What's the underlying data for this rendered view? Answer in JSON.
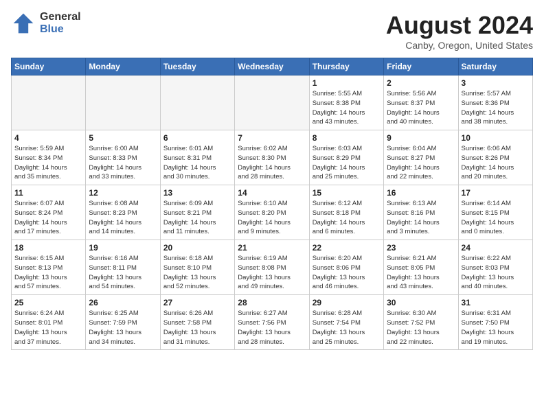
{
  "header": {
    "title": "August 2024",
    "location": "Canby, Oregon, United States",
    "logo_general": "General",
    "logo_blue": "Blue"
  },
  "weekdays": [
    "Sunday",
    "Monday",
    "Tuesday",
    "Wednesday",
    "Thursday",
    "Friday",
    "Saturday"
  ],
  "weeks": [
    [
      {
        "day": "",
        "info": ""
      },
      {
        "day": "",
        "info": ""
      },
      {
        "day": "",
        "info": ""
      },
      {
        "day": "",
        "info": ""
      },
      {
        "day": "1",
        "info": "Sunrise: 5:55 AM\nSunset: 8:38 PM\nDaylight: 14 hours\nand 43 minutes."
      },
      {
        "day": "2",
        "info": "Sunrise: 5:56 AM\nSunset: 8:37 PM\nDaylight: 14 hours\nand 40 minutes."
      },
      {
        "day": "3",
        "info": "Sunrise: 5:57 AM\nSunset: 8:36 PM\nDaylight: 14 hours\nand 38 minutes."
      }
    ],
    [
      {
        "day": "4",
        "info": "Sunrise: 5:59 AM\nSunset: 8:34 PM\nDaylight: 14 hours\nand 35 minutes."
      },
      {
        "day": "5",
        "info": "Sunrise: 6:00 AM\nSunset: 8:33 PM\nDaylight: 14 hours\nand 33 minutes."
      },
      {
        "day": "6",
        "info": "Sunrise: 6:01 AM\nSunset: 8:31 PM\nDaylight: 14 hours\nand 30 minutes."
      },
      {
        "day": "7",
        "info": "Sunrise: 6:02 AM\nSunset: 8:30 PM\nDaylight: 14 hours\nand 28 minutes."
      },
      {
        "day": "8",
        "info": "Sunrise: 6:03 AM\nSunset: 8:29 PM\nDaylight: 14 hours\nand 25 minutes."
      },
      {
        "day": "9",
        "info": "Sunrise: 6:04 AM\nSunset: 8:27 PM\nDaylight: 14 hours\nand 22 minutes."
      },
      {
        "day": "10",
        "info": "Sunrise: 6:06 AM\nSunset: 8:26 PM\nDaylight: 14 hours\nand 20 minutes."
      }
    ],
    [
      {
        "day": "11",
        "info": "Sunrise: 6:07 AM\nSunset: 8:24 PM\nDaylight: 14 hours\nand 17 minutes."
      },
      {
        "day": "12",
        "info": "Sunrise: 6:08 AM\nSunset: 8:23 PM\nDaylight: 14 hours\nand 14 minutes."
      },
      {
        "day": "13",
        "info": "Sunrise: 6:09 AM\nSunset: 8:21 PM\nDaylight: 14 hours\nand 11 minutes."
      },
      {
        "day": "14",
        "info": "Sunrise: 6:10 AM\nSunset: 8:20 PM\nDaylight: 14 hours\nand 9 minutes."
      },
      {
        "day": "15",
        "info": "Sunrise: 6:12 AM\nSunset: 8:18 PM\nDaylight: 14 hours\nand 6 minutes."
      },
      {
        "day": "16",
        "info": "Sunrise: 6:13 AM\nSunset: 8:16 PM\nDaylight: 14 hours\nand 3 minutes."
      },
      {
        "day": "17",
        "info": "Sunrise: 6:14 AM\nSunset: 8:15 PM\nDaylight: 14 hours\nand 0 minutes."
      }
    ],
    [
      {
        "day": "18",
        "info": "Sunrise: 6:15 AM\nSunset: 8:13 PM\nDaylight: 13 hours\nand 57 minutes."
      },
      {
        "day": "19",
        "info": "Sunrise: 6:16 AM\nSunset: 8:11 PM\nDaylight: 13 hours\nand 54 minutes."
      },
      {
        "day": "20",
        "info": "Sunrise: 6:18 AM\nSunset: 8:10 PM\nDaylight: 13 hours\nand 52 minutes."
      },
      {
        "day": "21",
        "info": "Sunrise: 6:19 AM\nSunset: 8:08 PM\nDaylight: 13 hours\nand 49 minutes."
      },
      {
        "day": "22",
        "info": "Sunrise: 6:20 AM\nSunset: 8:06 PM\nDaylight: 13 hours\nand 46 minutes."
      },
      {
        "day": "23",
        "info": "Sunrise: 6:21 AM\nSunset: 8:05 PM\nDaylight: 13 hours\nand 43 minutes."
      },
      {
        "day": "24",
        "info": "Sunrise: 6:22 AM\nSunset: 8:03 PM\nDaylight: 13 hours\nand 40 minutes."
      }
    ],
    [
      {
        "day": "25",
        "info": "Sunrise: 6:24 AM\nSunset: 8:01 PM\nDaylight: 13 hours\nand 37 minutes."
      },
      {
        "day": "26",
        "info": "Sunrise: 6:25 AM\nSunset: 7:59 PM\nDaylight: 13 hours\nand 34 minutes."
      },
      {
        "day": "27",
        "info": "Sunrise: 6:26 AM\nSunset: 7:58 PM\nDaylight: 13 hours\nand 31 minutes."
      },
      {
        "day": "28",
        "info": "Sunrise: 6:27 AM\nSunset: 7:56 PM\nDaylight: 13 hours\nand 28 minutes."
      },
      {
        "day": "29",
        "info": "Sunrise: 6:28 AM\nSunset: 7:54 PM\nDaylight: 13 hours\nand 25 minutes."
      },
      {
        "day": "30",
        "info": "Sunrise: 6:30 AM\nSunset: 7:52 PM\nDaylight: 13 hours\nand 22 minutes."
      },
      {
        "day": "31",
        "info": "Sunrise: 6:31 AM\nSunset: 7:50 PM\nDaylight: 13 hours\nand 19 minutes."
      }
    ]
  ]
}
